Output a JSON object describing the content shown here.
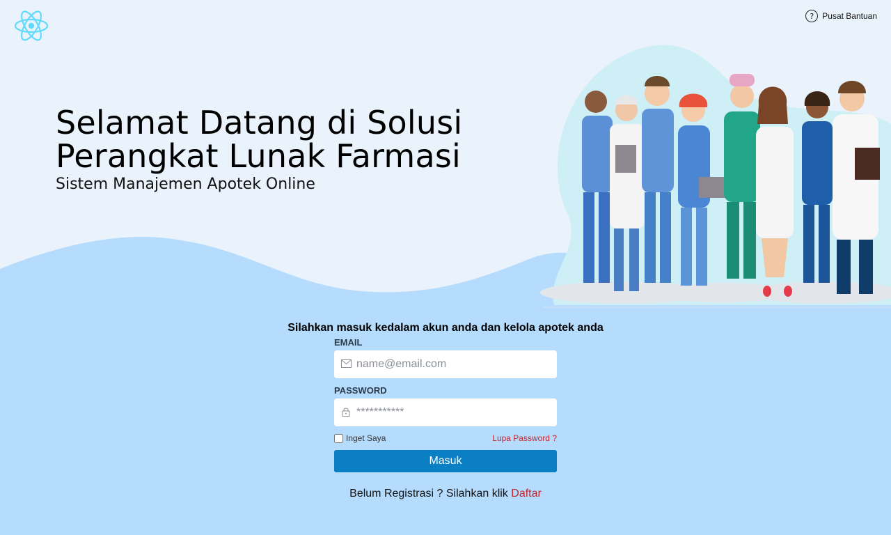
{
  "header": {
    "logo_icon": "react-atom-icon",
    "help_icon": "question-circle-icon",
    "help_label": "Pusat Bantuan",
    "help_icon_glyph": "?"
  },
  "hero": {
    "title": "Selamat Datang di Solusi Perangkat Lunak Farmasi",
    "subtitle": "Sistem Manajemen Apotek Online",
    "illustration": "medical-team-illustration"
  },
  "login": {
    "caption": "Silahkan masuk kedalam akun anda dan kelola apotek anda",
    "email_label": "EMAIL",
    "email_placeholder": "name@email.com",
    "email_icon": "mail-icon",
    "password_label": "PASSWORD",
    "password_placeholder": "***********",
    "password_icon": "lock-icon",
    "remember_label": "Inget Saya",
    "forgot_label": "Lupa Password ?",
    "submit_label": "Masuk",
    "register_text": "Belum Registrasi ? Silahkan klik",
    "register_link": "Daftar"
  },
  "colors": {
    "page_background": "#eaf2fb",
    "wave_background": "#b6dcfd",
    "primary_button": "#0a7fc4",
    "link_red": "#c0272d",
    "logo_cyan": "#61dafb"
  }
}
